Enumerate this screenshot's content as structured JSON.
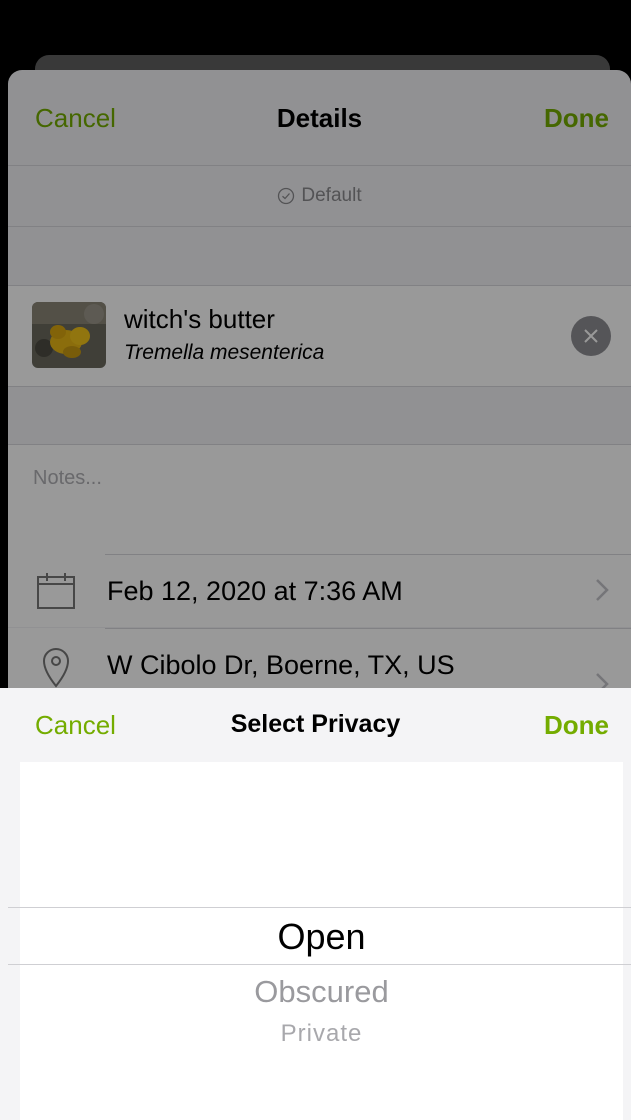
{
  "details": {
    "cancel_label": "Cancel",
    "title": "Details",
    "done_label": "Done",
    "default_label": "Default",
    "taxon": {
      "common_name": "witch's butter",
      "scientific_name": "Tremella mesenterica"
    },
    "notes_placeholder": "Notes...",
    "date_text": "Feb 12, 2020 at 7:36 AM",
    "location_text": "W Cibolo Dr, Boerne, TX, US"
  },
  "picker": {
    "cancel_label": "Cancel",
    "title": "Select Privacy",
    "done_label": "Done",
    "options": [
      "Open",
      "Obscured",
      "Private"
    ],
    "selected": "Open"
  },
  "colors": {
    "accent": "#74ac00",
    "overlay": "rgba(0,0,0,0.4)"
  }
}
